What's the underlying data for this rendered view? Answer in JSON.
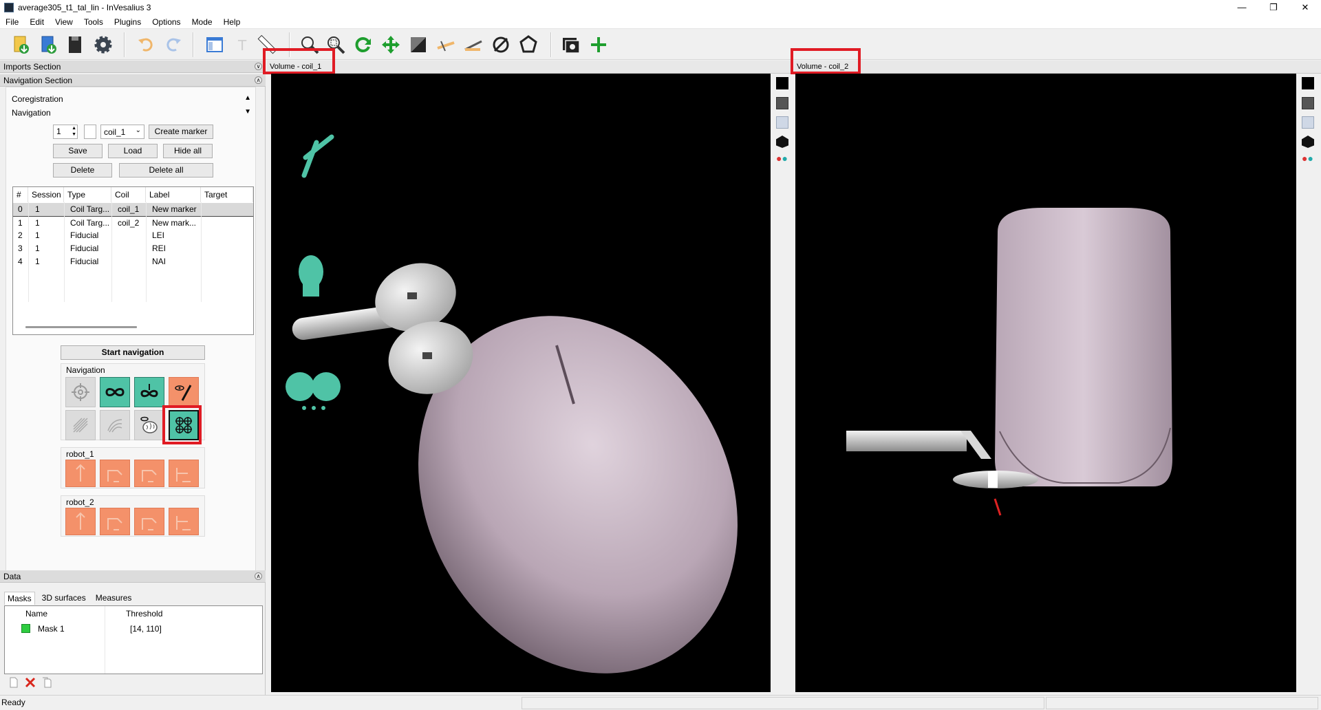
{
  "window": {
    "title": "average305_t1_tal_lin - InVesalius 3"
  },
  "menu": [
    "File",
    "Edit",
    "View",
    "Tools",
    "Plugins",
    "Options",
    "Mode",
    "Help"
  ],
  "left": {
    "imports_section": "Imports Section",
    "navigation_section": "Navigation Section",
    "coregistration": "Coregistration",
    "navigation": "Navigation",
    "marker_count": "1",
    "coil_select": "coil_1",
    "create_marker": "Create marker",
    "save": "Save",
    "load": "Load",
    "hide_all": "Hide all",
    "delete": "Delete",
    "delete_all": "Delete all",
    "table_headers": [
      "#",
      "Session",
      "Type",
      "Coil",
      "Label",
      "Target"
    ],
    "rows": [
      {
        "n": "0",
        "session": "1",
        "type": "Coil Targ...",
        "coil": "coil_1",
        "label": "New marker",
        "target": ""
      },
      {
        "n": "1",
        "session": "1",
        "type": "Coil Targ...",
        "coil": "coil_2",
        "label": "New mark...",
        "target": ""
      },
      {
        "n": "2",
        "session": "1",
        "type": "Fiducial",
        "coil": "",
        "label": "LEI",
        "target": ""
      },
      {
        "n": "3",
        "session": "1",
        "type": "Fiducial",
        "coil": "",
        "label": "REI",
        "target": ""
      },
      {
        "n": "4",
        "session": "1",
        "type": "Fiducial",
        "coil": "",
        "label": "NAI",
        "target": ""
      }
    ],
    "start_navigation": "Start navigation",
    "nav_group_label": "Navigation",
    "robot1": "robot_1",
    "robot2": "robot_2"
  },
  "data": {
    "header": "Data",
    "tabs": [
      "Masks",
      "3D surfaces",
      "Measures"
    ],
    "mask_headers": [
      "Name",
      "Threshold"
    ],
    "masks": [
      {
        "name": "Mask 1",
        "threshold": "[14, 110]",
        "color": "#2ecc40"
      }
    ]
  },
  "viewports": [
    {
      "title": "Volume - coil_1"
    },
    {
      "title": "Volume - coil_2"
    }
  ],
  "status": {
    "text": "Ready"
  },
  "colors": {
    "teal": "#4fc3a6",
    "orange": "#f4916a",
    "highlight": "#e01b24",
    "surface": "#c9b8c6"
  }
}
